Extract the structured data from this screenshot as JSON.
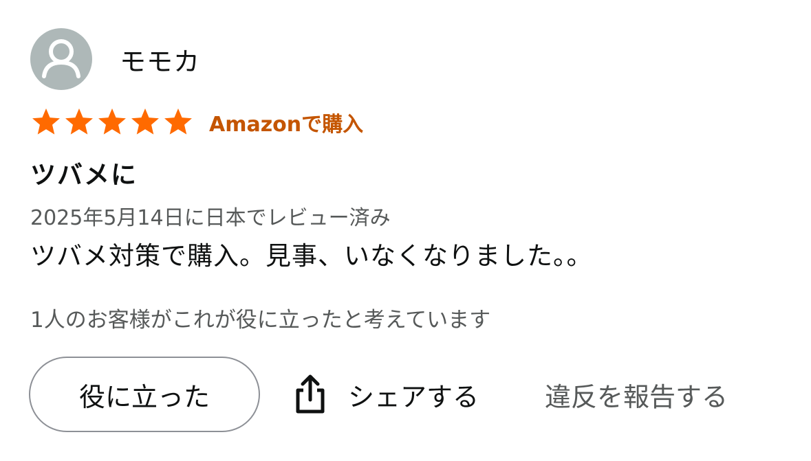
{
  "review": {
    "reviewer_name": "モモカ",
    "avatar_icon": "user-avatar-icon",
    "rating": 5,
    "rating_max": 5,
    "star_color": "#ff6a00",
    "verified_label": "Amazonで購入",
    "verified_color": "#c45500",
    "title": "ツバメに",
    "date_text": "2025年5月14日に日本でレビュー済み",
    "body": "ツバメ対策で購入。見事、いなくなりました。。",
    "helpful_count_text": "1人のお客様がこれが役に立ったと考えています"
  },
  "actions": {
    "helpful_label": "役に立った",
    "share_label": "シェアする",
    "share_icon": "share-icon",
    "report_label": "違反を報告する"
  }
}
